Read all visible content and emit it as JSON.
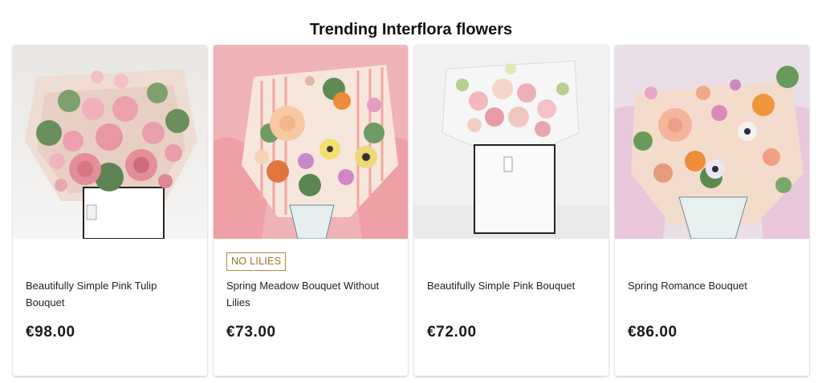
{
  "section": {
    "title": "Trending Interflora flowers"
  },
  "products": [
    {
      "name": "Beautifully Simple Pink Tulip Bouquet",
      "price": "€98.00",
      "badge": "",
      "image_icon": "bouquet-image"
    },
    {
      "name": "Spring Meadow Bouquet Without Lilies",
      "price": "€73.00",
      "badge": "NO LILIES",
      "image_icon": "bouquet-image"
    },
    {
      "name": "Beautifully Simple Pink Bouquet",
      "price": "€72.00",
      "badge": "",
      "image_icon": "bouquet-image"
    },
    {
      "name": "Spring Romance Bouquet",
      "price": "€86.00",
      "badge": "",
      "image_icon": "bouquet-image"
    }
  ],
  "colors": {
    "badge_border": "#b08a3e",
    "badge_text": "#9a7325",
    "price_text": "#1a1a1a"
  }
}
